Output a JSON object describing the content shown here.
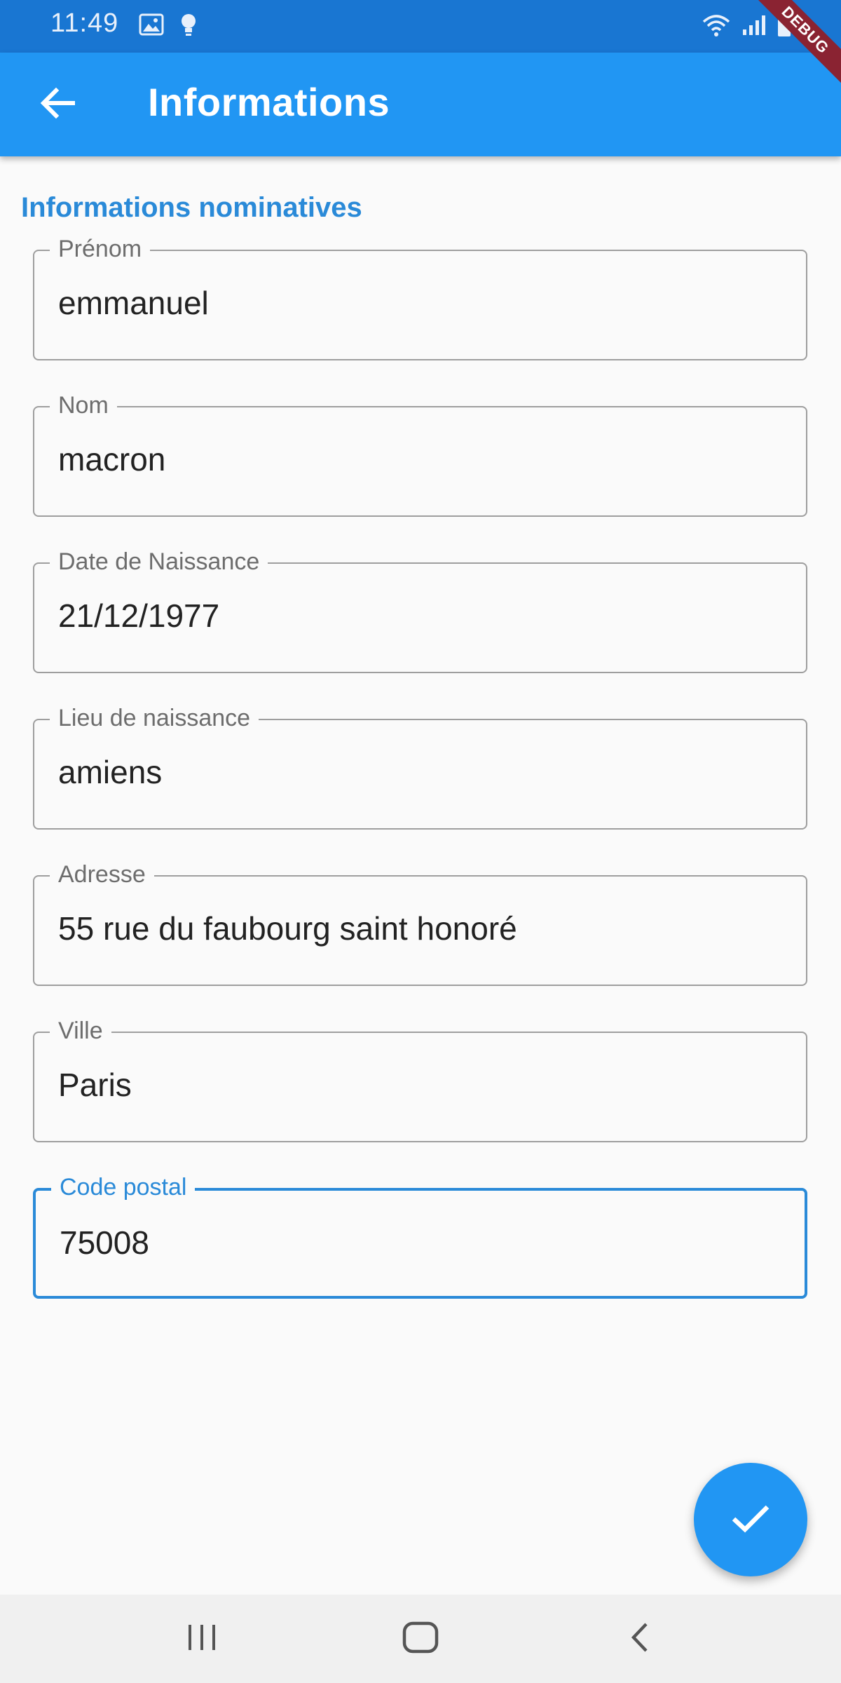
{
  "status_bar": {
    "time": "11:49",
    "icons": [
      "image-icon",
      "bulb-icon",
      "wifi-icon",
      "signal-icon",
      "battery-icon"
    ],
    "debug_banner": "DEBUG"
  },
  "app_bar": {
    "title": "Informations",
    "back_icon": "arrow-back-icon",
    "background": "#2196f3"
  },
  "section": {
    "title": "Informations nominatives"
  },
  "fields": [
    {
      "label": "Prénom",
      "value": "emmanuel",
      "focused": false
    },
    {
      "label": "Nom",
      "value": "macron",
      "focused": false
    },
    {
      "label": "Date de Naissance",
      "value": "21/12/1977",
      "focused": false
    },
    {
      "label": "Lieu de naissance",
      "value": "amiens",
      "focused": false
    },
    {
      "label": "Adresse",
      "value": "55 rue du faubourg saint honoré",
      "focused": false
    },
    {
      "label": "Ville",
      "value": "Paris",
      "focused": false
    },
    {
      "label": "Code postal",
      "value": "75008",
      "focused": true
    }
  ],
  "fab": {
    "icon": "check-icon"
  },
  "nav_bar": {
    "buttons": [
      "recent-apps-icon",
      "home-icon",
      "back-icon"
    ]
  },
  "colors": {
    "status_bar": "#1976d2",
    "primary": "#2196f3",
    "accent": "#2a8ad8"
  }
}
